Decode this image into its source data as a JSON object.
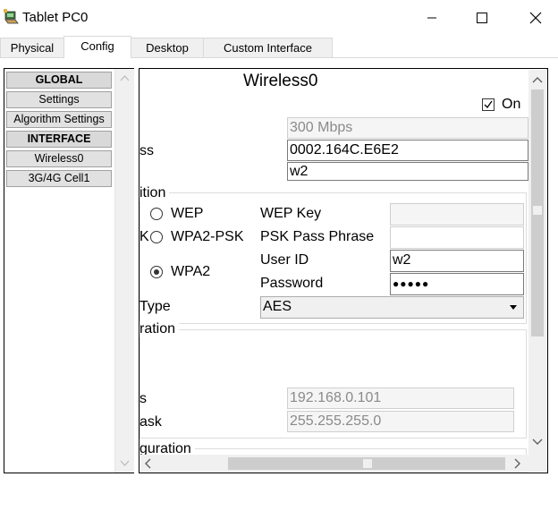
{
  "window": {
    "title": "Tablet PC0"
  },
  "tabs": [
    {
      "label": "Physical"
    },
    {
      "label": "Config"
    },
    {
      "label": "Desktop"
    },
    {
      "label": "Custom Interface"
    }
  ],
  "sidebar": {
    "items": [
      {
        "label": "GLOBAL"
      },
      {
        "label": "Settings"
      },
      {
        "label": "Algorithm Settings"
      },
      {
        "label": "INTERFACE"
      },
      {
        "label": "Wireless0"
      },
      {
        "label": "3G/4G Cell1"
      }
    ]
  },
  "wireless": {
    "heading": "Wireless0",
    "on_label": "On",
    "on_checked": true,
    "bandwidth": "300 Mbps",
    "mac_label_partial": "ss",
    "mac_address": "0002.164C.E6E2",
    "ssid": "w2",
    "auth_section_partial": "ition",
    "auth_options": {
      "wep": "WEP",
      "wpa2psk": "WPA2-PSK",
      "wpa2": "WPA2",
      "wpa2psk_prefix_partial": "K",
      "selected": "WPA2"
    },
    "wep_key_label": "WEP Key",
    "psk_label": "PSK Pass Phrase",
    "user_id_label": "User ID",
    "user_id_value": "w2",
    "password_label": "Password",
    "password_mask": "●●●●●",
    "encryption_label_partial": "Type",
    "encryption_value": "AES",
    "ip_section_partial": "ration",
    "ip_label_partial": "s",
    "ip_address": "192.168.0.101",
    "mask_label_partial": "ask",
    "subnet_mask": "255.255.255.0",
    "ipv6_section_partial": "guration"
  }
}
